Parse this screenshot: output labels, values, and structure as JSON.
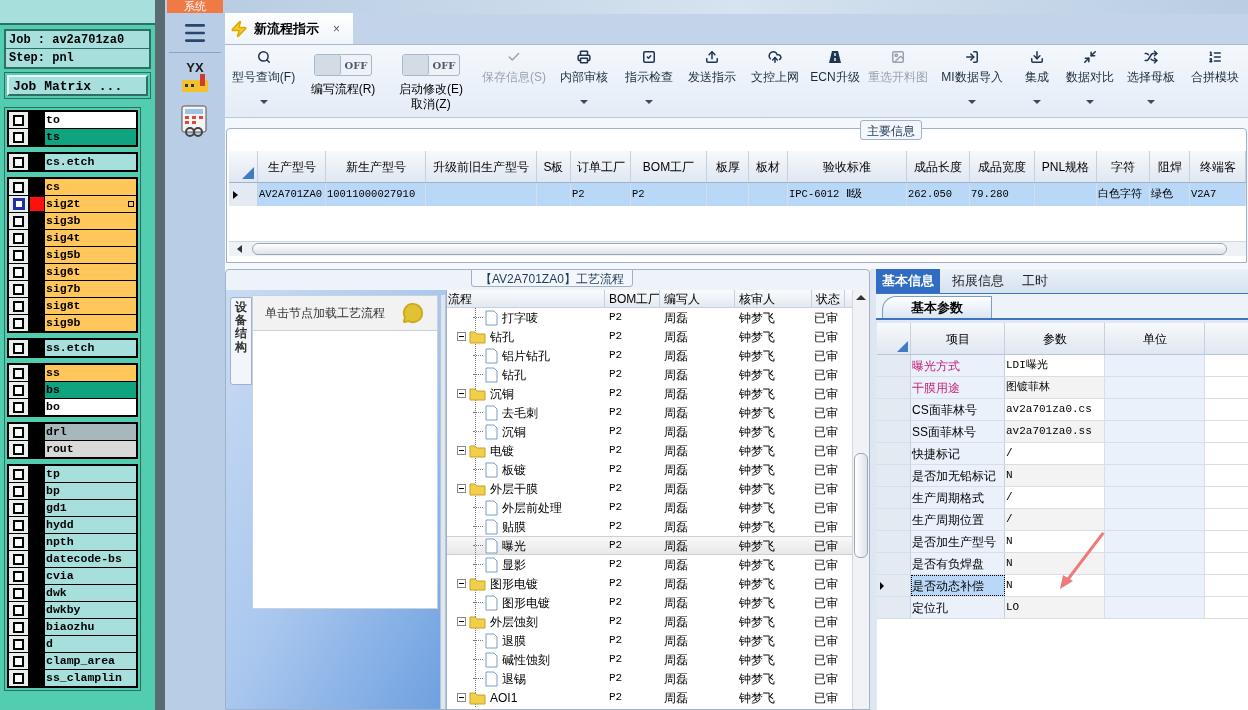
{
  "layers_panel": {
    "job": "Job : av2a701za0",
    "step": "Step: pnl",
    "matrix_button": "Job Matrix ...",
    "groups": [
      [
        {
          "name": "to",
          "color": "#ffffff",
          "selected": false
        },
        {
          "name": "ts",
          "color": "#0fa37f",
          "selected": false
        }
      ],
      [
        {
          "name": "cs.etch",
          "color": "#a6dfdb",
          "selected": false
        }
      ],
      [
        {
          "name": "cs",
          "color": "#ffc65a",
          "selected": false
        },
        {
          "name": "sig2t",
          "color": "#ffc65a",
          "selected": true
        },
        {
          "name": "sig3b",
          "color": "#ffc65a",
          "selected": false
        },
        {
          "name": "sig4t",
          "color": "#ffc65a",
          "selected": false
        },
        {
          "name": "sig5b",
          "color": "#ffc65a",
          "selected": false
        },
        {
          "name": "sig6t",
          "color": "#ffc65a",
          "selected": false
        },
        {
          "name": "sig7b",
          "color": "#ffc65a",
          "selected": false
        },
        {
          "name": "sig8t",
          "color": "#ffc65a",
          "selected": false
        },
        {
          "name": "sig9b",
          "color": "#ffc65a",
          "selected": false
        }
      ],
      [
        {
          "name": "ss.etch",
          "color": "#a6dfdb",
          "selected": false
        }
      ],
      [
        {
          "name": "ss",
          "color": "#ffc65a",
          "selected": false
        },
        {
          "name": "bs",
          "color": "#0fa37f",
          "selected": false
        },
        {
          "name": "bo",
          "color": "#ffffff",
          "selected": false
        }
      ],
      [
        {
          "name": "drl",
          "color": "#a7b8bc",
          "selected": false
        },
        {
          "name": "rout",
          "color": "#d9d9d9",
          "selected": false
        }
      ],
      [
        {
          "name": "tp",
          "color": "#a6dfdb",
          "selected": false
        },
        {
          "name": "bp",
          "color": "#a6dfdb",
          "selected": false
        },
        {
          "name": "gd1",
          "color": "#a6dfdb",
          "selected": false
        },
        {
          "name": "hydd",
          "color": "#a6dfdb",
          "selected": false
        },
        {
          "name": "npth",
          "color": "#a6dfdb",
          "selected": false
        },
        {
          "name": "datecode-bs",
          "color": "#a6dfdb",
          "selected": false
        },
        {
          "name": "cvia",
          "color": "#a6dfdb",
          "selected": false
        },
        {
          "name": "dwk",
          "color": "#a6dfdb",
          "selected": false
        },
        {
          "name": "dwkby",
          "color": "#a6dfdb",
          "selected": false
        },
        {
          "name": "biaozhu",
          "color": "#a6dfdb",
          "selected": false
        },
        {
          "name": "d",
          "color": "#a6dfdb",
          "selected": false
        },
        {
          "name": "clamp_area",
          "color": "#a6dfdb",
          "selected": false
        },
        {
          "name": "ss_clamplin",
          "color": "#a6dfdb",
          "selected": false
        }
      ]
    ]
  },
  "sidebar": {
    "tab": "系统",
    "logo": "YX"
  },
  "document_tab": {
    "title": "新流程指示",
    "close": "×"
  },
  "toolbar": [
    {
      "kind": "button",
      "label": "型号查询(F)",
      "disabled": false,
      "dropdown": true
    },
    {
      "kind": "toggle",
      "state_text": "OFF",
      "on": false,
      "label": "编写流程(R)"
    },
    {
      "kind": "toggle",
      "state_text": "OFF",
      "on": false,
      "label": "启动修改(E)",
      "label_2": "取消(Z)"
    },
    {
      "kind": "button",
      "label": "保存信息(S)",
      "disabled": true,
      "dropdown": false
    },
    {
      "kind": "button",
      "label": "内部审核",
      "disabled": false,
      "dropdown": true
    },
    {
      "kind": "button",
      "label": "指示检查",
      "disabled": false,
      "dropdown": true
    },
    {
      "kind": "button",
      "label": "发送指示",
      "disabled": false,
      "dropdown": false
    },
    {
      "kind": "button",
      "label": "文控上网",
      "disabled": false,
      "dropdown": false
    },
    {
      "kind": "button",
      "label": "ECN升级",
      "disabled": false,
      "dropdown": false
    },
    {
      "kind": "button",
      "label": "重选开料图",
      "disabled": true,
      "dropdown": false
    },
    {
      "kind": "button",
      "label": "MI数据导入",
      "disabled": false,
      "dropdown": true
    },
    {
      "kind": "button",
      "label": "集成",
      "disabled": false,
      "dropdown": true
    },
    {
      "kind": "button",
      "label": "数据对比",
      "disabled": false,
      "dropdown": true
    },
    {
      "kind": "button",
      "label": "选择母板",
      "disabled": false,
      "dropdown": true
    },
    {
      "kind": "button",
      "label": "合拼模块",
      "disabled": false,
      "dropdown": false
    }
  ],
  "main_info": {
    "title": "主要信息",
    "columns": [
      "生产型号",
      "新生产型号",
      "升级前旧生产型号",
      "S板",
      "订单工厂",
      "BOM工厂",
      "板厚",
      "板材",
      "验收标准",
      "成品长度",
      "成品宽度",
      "PNL规格",
      "字符",
      "阻焊",
      "终端客"
    ],
    "rows": [
      {
        "selected": true,
        "cells": [
          "AV2A701ZA0",
          "10011000027910",
          "",
          "",
          "P2",
          "P2",
          "",
          "",
          "IPC-6012 Ⅱ级",
          "262.050",
          "79.280",
          "",
          "白色字符",
          "绿色",
          "V2A7"
        ]
      }
    ]
  },
  "process": {
    "title": "【AV2A701ZA0】工艺流程",
    "side_tab": "设备结构",
    "hint": "单击节点加载工艺流程",
    "columns": [
      "流程",
      "BOM工厂",
      "编写人",
      "核审人",
      "状态"
    ],
    "tree": [
      {
        "kind": "file",
        "name": "打字唛",
        "bom": "P2",
        "writer": "周磊",
        "reviewer": "钟梦飞",
        "status": "已审",
        "selected": false
      },
      {
        "kind": "folder",
        "expanded": true,
        "name": "钻孔",
        "bom": "P2",
        "writer": "周磊",
        "reviewer": "钟梦飞",
        "status": "已审",
        "selected": false,
        "children": [
          {
            "kind": "file",
            "name": "铝片钻孔",
            "bom": "P2",
            "writer": "周磊",
            "reviewer": "钟梦飞",
            "status": "已审",
            "selected": false
          },
          {
            "kind": "file",
            "name": "钻孔",
            "bom": "P2",
            "writer": "周磊",
            "reviewer": "钟梦飞",
            "status": "已审",
            "selected": false
          }
        ]
      },
      {
        "kind": "folder",
        "expanded": true,
        "name": "沉铜",
        "bom": "P2",
        "writer": "周磊",
        "reviewer": "钟梦飞",
        "status": "已审",
        "selected": false,
        "children": [
          {
            "kind": "file",
            "name": "去毛刺",
            "bom": "P2",
            "writer": "周磊",
            "reviewer": "钟梦飞",
            "status": "已审",
            "selected": false
          },
          {
            "kind": "file",
            "name": "沉铜",
            "bom": "P2",
            "writer": "周磊",
            "reviewer": "钟梦飞",
            "status": "已审",
            "selected": false
          }
        ]
      },
      {
        "kind": "folder",
        "expanded": true,
        "name": "电镀",
        "bom": "P2",
        "writer": "周磊",
        "reviewer": "钟梦飞",
        "status": "已审",
        "selected": false,
        "children": [
          {
            "kind": "file",
            "name": "板镀",
            "bom": "P2",
            "writer": "周磊",
            "reviewer": "钟梦飞",
            "status": "已审",
            "selected": false
          }
        ]
      },
      {
        "kind": "folder",
        "expanded": true,
        "name": "外层干膜",
        "bom": "P2",
        "writer": "周磊",
        "reviewer": "钟梦飞",
        "status": "已审",
        "selected": false,
        "children": [
          {
            "kind": "file",
            "name": "外层前处理",
            "bom": "P2",
            "writer": "周磊",
            "reviewer": "钟梦飞",
            "status": "已审",
            "selected": false
          },
          {
            "kind": "file",
            "name": "贴膜",
            "bom": "P2",
            "writer": "周磊",
            "reviewer": "钟梦飞",
            "status": "已审",
            "selected": false
          },
          {
            "kind": "file",
            "name": "曝光",
            "bom": "P2",
            "writer": "周磊",
            "reviewer": "钟梦飞",
            "status": "已审",
            "selected": true
          },
          {
            "kind": "file",
            "name": "显影",
            "bom": "P2",
            "writer": "周磊",
            "reviewer": "钟梦飞",
            "status": "已审",
            "selected": false
          }
        ]
      },
      {
        "kind": "folder",
        "expanded": true,
        "name": "图形电镀",
        "bom": "P2",
        "writer": "周磊",
        "reviewer": "钟梦飞",
        "status": "已审",
        "selected": false,
        "children": [
          {
            "kind": "file",
            "name": "图形电镀",
            "bom": "P2",
            "writer": "周磊",
            "reviewer": "钟梦飞",
            "status": "已审",
            "selected": false
          }
        ]
      },
      {
        "kind": "folder",
        "expanded": true,
        "name": "外层蚀刻",
        "bom": "P2",
        "writer": "周磊",
        "reviewer": "钟梦飞",
        "status": "已审",
        "selected": false,
        "children": [
          {
            "kind": "file",
            "name": "退膜",
            "bom": "P2",
            "writer": "周磊",
            "reviewer": "钟梦飞",
            "status": "已审",
            "selected": false
          },
          {
            "kind": "file",
            "name": "碱性蚀刻",
            "bom": "P2",
            "writer": "周磊",
            "reviewer": "钟梦飞",
            "status": "已审",
            "selected": false
          },
          {
            "kind": "file",
            "name": "退锡",
            "bom": "P2",
            "writer": "周磊",
            "reviewer": "钟梦飞",
            "status": "已审",
            "selected": false
          }
        ]
      },
      {
        "kind": "folder",
        "expanded": true,
        "name": "AOI1",
        "bom": "P2",
        "writer": "周磊",
        "reviewer": "钟梦飞",
        "status": "已审",
        "selected": false
      }
    ]
  },
  "details": {
    "tabs": [
      {
        "label": "基本信息",
        "selected": true
      },
      {
        "label": "拓展信息",
        "selected": false
      },
      {
        "label": "工时",
        "selected": false
      }
    ],
    "subtab": "基本参数",
    "columns": [
      "项目",
      "参数",
      "单位"
    ],
    "rows": [
      {
        "item": "曝光方式",
        "value": "LDI曝光",
        "highlighted": true,
        "selected": false
      },
      {
        "item": "干膜用途",
        "value": "图镀菲林",
        "highlighted": true,
        "selected": false
      },
      {
        "item": "CS面菲林号",
        "value": "av2a701za0.cs",
        "highlighted": false,
        "selected": false
      },
      {
        "item": "SS面菲林号",
        "value": "av2a701za0.ss",
        "highlighted": false,
        "selected": false
      },
      {
        "item": "快捷标记",
        "value": "/",
        "highlighted": false,
        "selected": false
      },
      {
        "item": "是否加无铅标记",
        "value": "N",
        "highlighted": false,
        "selected": false
      },
      {
        "item": "生产周期格式",
        "value": "/",
        "highlighted": false,
        "selected": false
      },
      {
        "item": "生产周期位置",
        "value": "/",
        "highlighted": false,
        "selected": false
      },
      {
        "item": "是否加生产型号",
        "value": "N",
        "highlighted": false,
        "selected": false
      },
      {
        "item": "是否有负焊盘",
        "value": "N",
        "highlighted": false,
        "selected": false
      },
      {
        "item": "是否动态补偿",
        "value": "N",
        "highlighted": false,
        "selected": true
      },
      {
        "item": "定位孔",
        "value": "LO",
        "highlighted": false,
        "selected": false
      }
    ]
  }
}
